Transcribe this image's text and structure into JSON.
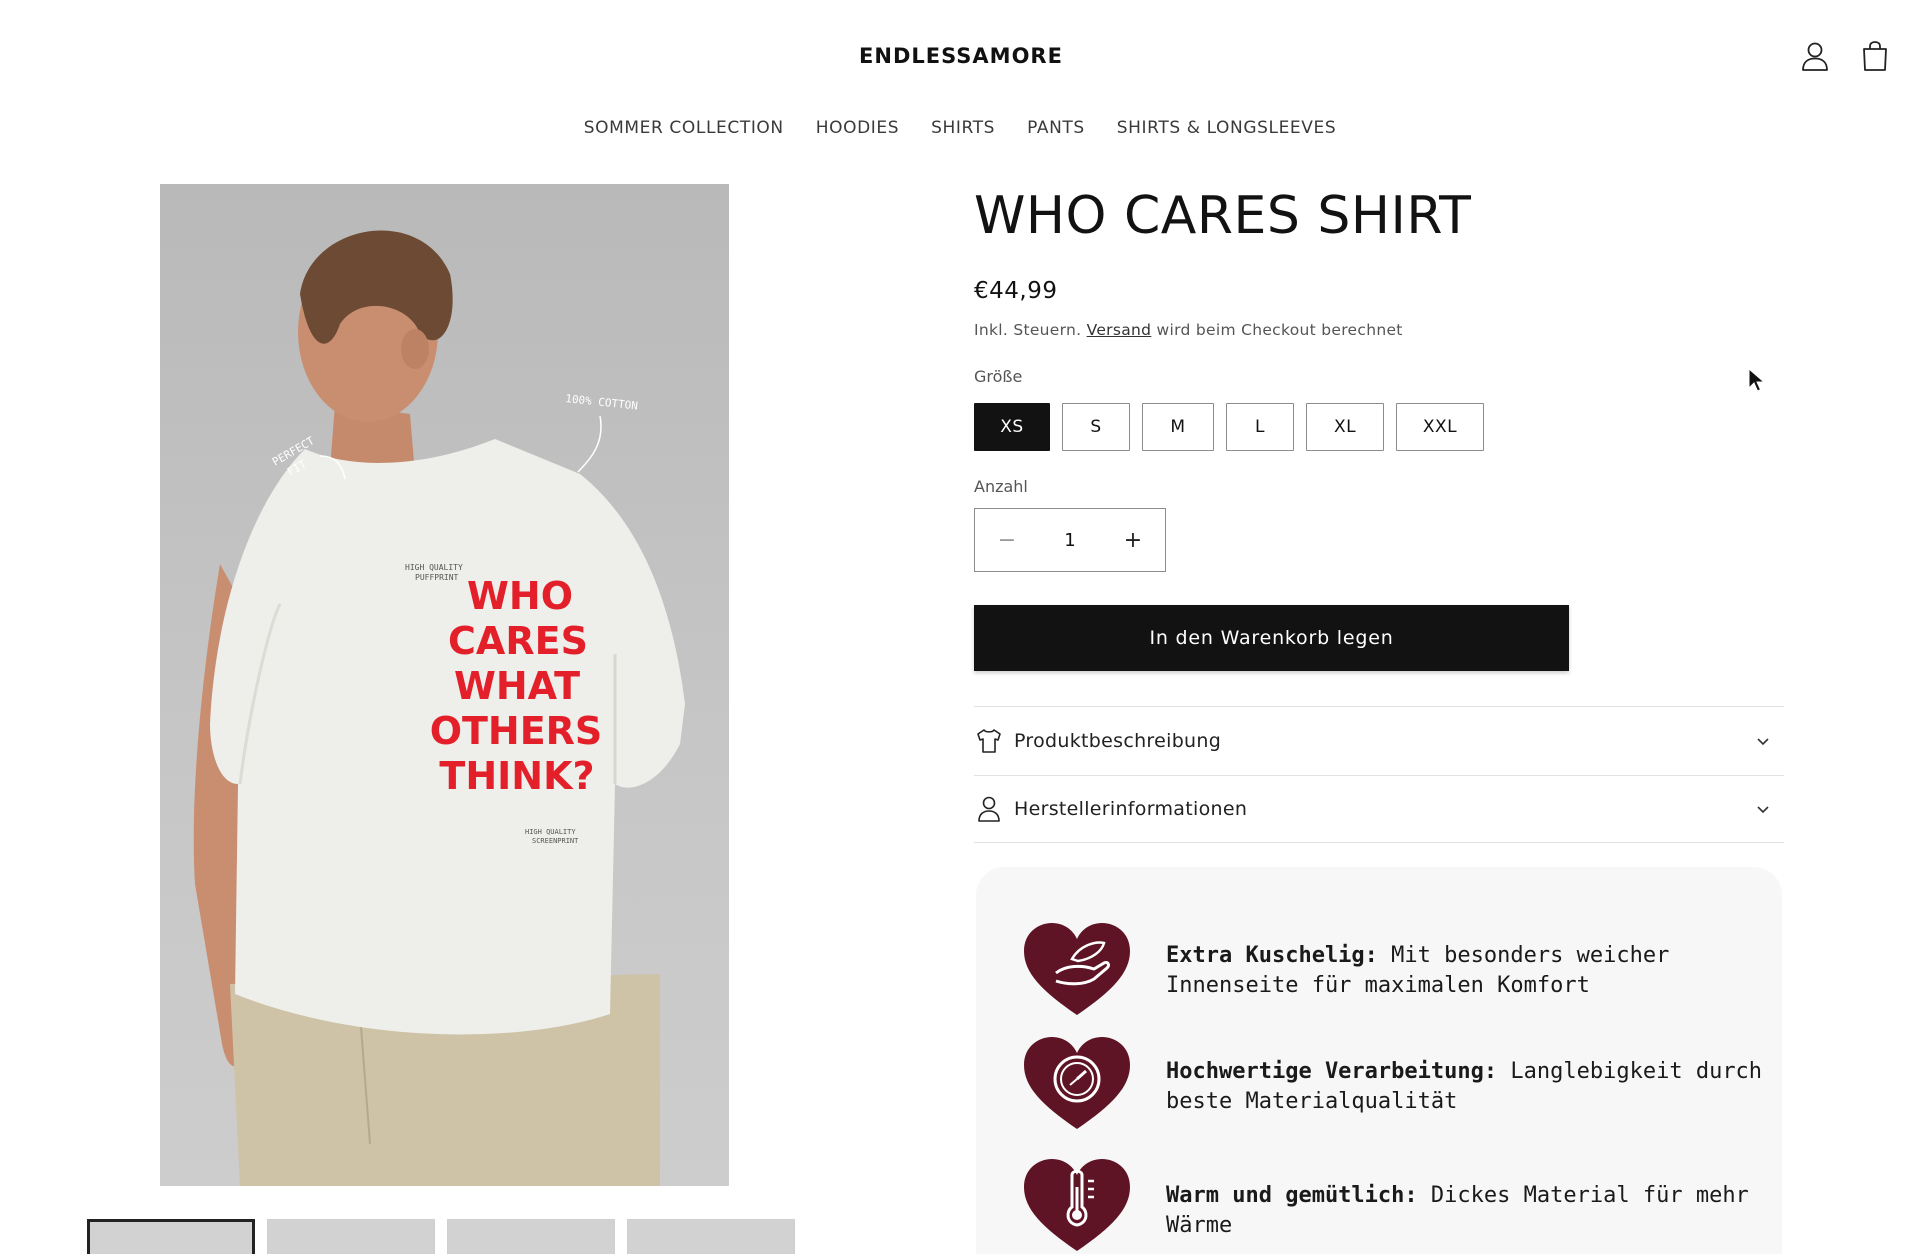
{
  "header": {
    "logo": "ENDLESSAMORE",
    "icons": [
      "account-icon",
      "cart-icon"
    ]
  },
  "nav": {
    "items": [
      "SOMMER COLLECTION",
      "HOODIES",
      "SHIRTS",
      "PANTS",
      "SHIRTS & LONGSLEEVES"
    ]
  },
  "gallery": {
    "print_lines": [
      "WHO",
      "CARES",
      "WHAT",
      "OTHERS",
      "THINK?"
    ],
    "annotations": {
      "cotton": "100% COTTON",
      "fit_line1": "PERFECT",
      "fit_line2": "FIT",
      "puffprint_line1": "HIGH QUALITY",
      "puffprint_line2": "PUFFPRINT",
      "screenprint_line1": "HIGH QUALITY",
      "screenprint_line2": "SCREENPRINT"
    },
    "thumbnail_count": 4
  },
  "product": {
    "title": "WHO CARES SHIRT",
    "price": "€44,99",
    "tax_prefix": "Inkl. Steuern.",
    "shipping_link": "Versand",
    "tax_suffix": "wird beim Checkout berechnet",
    "size_label": "Größe",
    "sizes": [
      "XS",
      "S",
      "M",
      "L",
      "XL",
      "XXL"
    ],
    "selected_size": "XS",
    "quantity_label": "Anzahl",
    "quantity": "1",
    "minus": "−",
    "plus": "+",
    "add_to_cart": "In den Warenkorb legen"
  },
  "accordions": [
    {
      "label": "Produktbeschreibung",
      "icon": "tshirt-icon"
    },
    {
      "label": "Herstellerinformationen",
      "icon": "person-icon"
    }
  ],
  "features": [
    {
      "title": "Extra Kuschelig:",
      "text": "Mit besonders weicher Innenseite für maximalen Komfort",
      "icon": "feather-hand-icon"
    },
    {
      "title": "Hochwertige Verarbeitung:",
      "text": "Langlebigkeit durch beste Materialqualität",
      "icon": "clock-icon"
    },
    {
      "title": "Warm und gemütlich:",
      "text": "Dickes Material für mehr Wärme",
      "icon": "thermometer-icon"
    }
  ],
  "colors": {
    "accent": "#121212",
    "heart": "#5e1424",
    "print_red": "#e3202a"
  }
}
